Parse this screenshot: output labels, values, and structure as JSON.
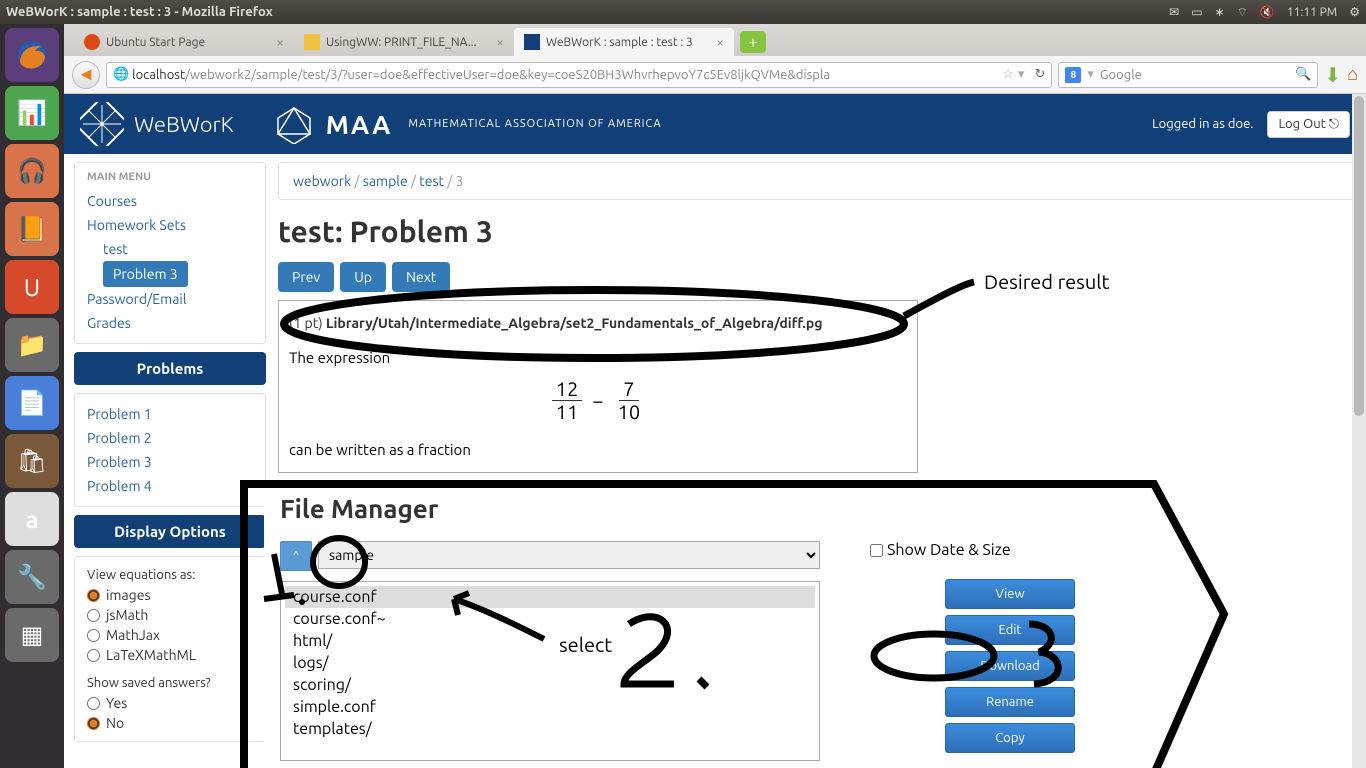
{
  "window_title": "WeBWorK : sample : test : 3 - Mozilla Firefox",
  "clock": "11:11 PM",
  "tabs": [
    {
      "label": "Ubuntu Start Page",
      "active": false
    },
    {
      "label": "UsingWW: PRINT_FILE_NA...",
      "active": false
    },
    {
      "label": "WeBWorK : sample : test : 3",
      "active": true
    }
  ],
  "url_host": "localhost",
  "url_path": "/webwork2/sample/test/3/?user=doe&effectiveUser=doe&key=coeS20BH3WhvrhepvoY7c5Ev8ljkQVMe&displa",
  "search_placeholder": "Google",
  "ww": {
    "brand": "WeBWorK",
    "maa_sub": "MATHEMATICAL ASSOCIATION OF AMERICA",
    "logged_in": "Logged in as doe.",
    "logout": "Log Out"
  },
  "sidebar": {
    "main_menu": "MAIN MENU",
    "courses": "Courses",
    "hw": "Homework Sets",
    "test": "test",
    "problem3": "Problem 3",
    "pw": "Password/Email",
    "grades": "Grades",
    "problems_head": "Problems",
    "problems": [
      "Problem 1",
      "Problem 2",
      "Problem 3",
      "Problem 4"
    ],
    "display_head": "Display Options",
    "view_as": "View equations as:",
    "opts": [
      "images",
      "jsMath",
      "MathJax",
      "LaTeXMathML"
    ],
    "saved_q": "Show saved answers?",
    "yes": "Yes",
    "no": "No"
  },
  "breadcrumb": {
    "a": "webwork",
    "b": "sample",
    "c": "test",
    "d": "3"
  },
  "page_title": "test: Problem 3",
  "nav": {
    "prev": "Prev",
    "up": "Up",
    "next": "Next"
  },
  "problem": {
    "pts": "(1 pt) ",
    "path": "Library/Utah/Intermediate_Algebra/set2_Fundamentals_of_Algebra/diff.pg",
    "text1": "The expression",
    "f1n": "12",
    "f1d": "11",
    "minus": "−",
    "f2n": "7",
    "f2d": "10",
    "text2": "can be written as a fraction"
  },
  "annotation_desired": "Desired result",
  "annotation_select": "select",
  "fm": {
    "title": "File Manager",
    "up": "^",
    "path": "sample",
    "show_date": "Show Date & Size",
    "files": [
      "course.conf",
      "course.conf~",
      "html/",
      "logs/",
      "scoring/",
      "simple.conf",
      "templates/"
    ],
    "btns": [
      "View",
      "Edit",
      "Download",
      "Rename",
      "Copy"
    ]
  }
}
